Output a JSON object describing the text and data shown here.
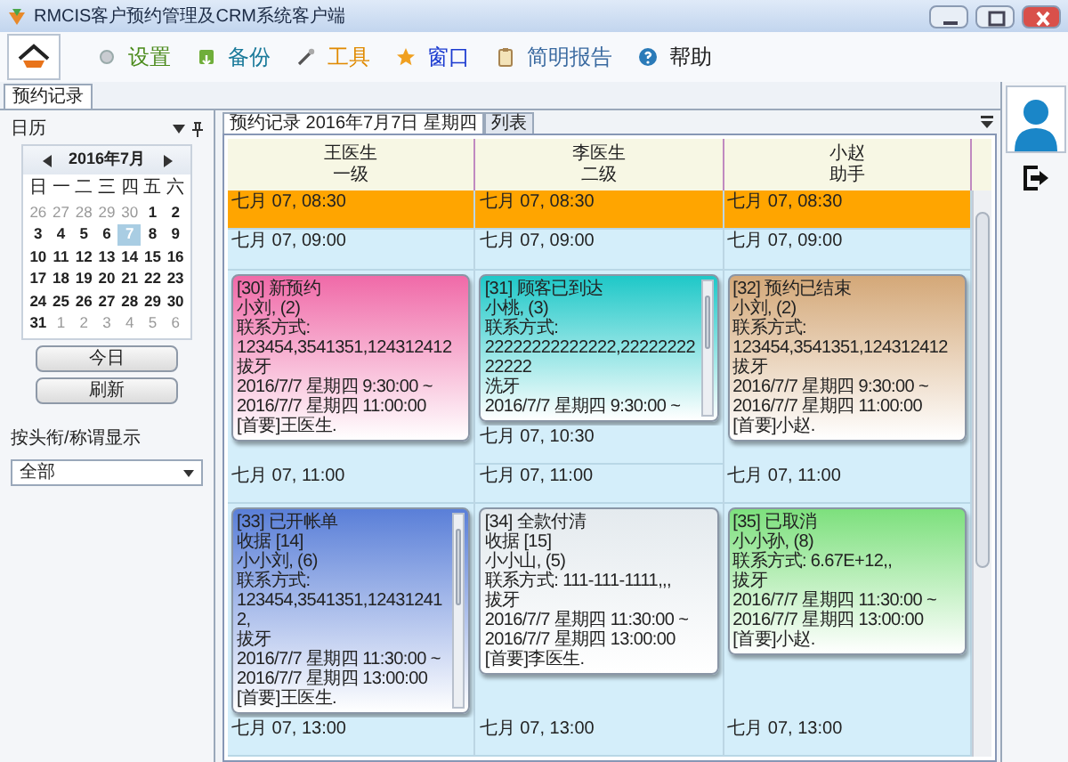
{
  "window": {
    "title": "RMCIS客户预约管理及CRM系统客户端"
  },
  "toolbar": [
    {
      "label": "设置",
      "color": "#4a8a1a"
    },
    {
      "label": "备份",
      "color": "#1a7a9a"
    },
    {
      "label": "工具",
      "color": "#e08a00"
    },
    {
      "label": "窗口",
      "color": "#1a3ad0"
    },
    {
      "label": "简明报告",
      "color": "#3a6aa0"
    },
    {
      "label": "帮助",
      "color": "#222222"
    }
  ],
  "tabs": [
    {
      "label": "预约记录",
      "selected": true
    }
  ],
  "calendar": {
    "title": "日历",
    "month": "2016年7月",
    "weekdays": [
      "日",
      "一",
      "二",
      "三",
      "四",
      "五",
      "六"
    ],
    "weeks": [
      [
        {
          "day": "26",
          "muted": true,
          "selected": false
        },
        {
          "day": "27",
          "muted": true,
          "selected": false
        },
        {
          "day": "28",
          "muted": true,
          "selected": false
        },
        {
          "day": "29",
          "muted": true,
          "selected": false
        },
        {
          "day": "30",
          "muted": true,
          "selected": false
        },
        {
          "day": "1",
          "muted": false,
          "selected": false
        },
        {
          "day": "2",
          "muted": false,
          "selected": false
        }
      ],
      [
        {
          "day": "3",
          "muted": false,
          "selected": false
        },
        {
          "day": "4",
          "muted": false,
          "selected": false
        },
        {
          "day": "5",
          "muted": false,
          "selected": false
        },
        {
          "day": "6",
          "muted": false,
          "selected": false
        },
        {
          "day": "7",
          "muted": false,
          "selected": true
        },
        {
          "day": "8",
          "muted": false,
          "selected": false
        },
        {
          "day": "9",
          "muted": false,
          "selected": false
        }
      ],
      [
        {
          "day": "10",
          "muted": false,
          "selected": false
        },
        {
          "day": "11",
          "muted": false,
          "selected": false
        },
        {
          "day": "12",
          "muted": false,
          "selected": false
        },
        {
          "day": "13",
          "muted": false,
          "selected": false
        },
        {
          "day": "14",
          "muted": false,
          "selected": false
        },
        {
          "day": "15",
          "muted": false,
          "selected": false
        },
        {
          "day": "16",
          "muted": false,
          "selected": false
        }
      ],
      [
        {
          "day": "17",
          "muted": false,
          "selected": false
        },
        {
          "day": "18",
          "muted": false,
          "selected": false
        },
        {
          "day": "19",
          "muted": false,
          "selected": false
        },
        {
          "day": "20",
          "muted": false,
          "selected": false
        },
        {
          "day": "21",
          "muted": false,
          "selected": false
        },
        {
          "day": "22",
          "muted": false,
          "selected": false
        },
        {
          "day": "23",
          "muted": false,
          "selected": false
        }
      ],
      [
        {
          "day": "24",
          "muted": false,
          "selected": false
        },
        {
          "day": "25",
          "muted": false,
          "selected": false
        },
        {
          "day": "26",
          "muted": false,
          "selected": false
        },
        {
          "day": "27",
          "muted": false,
          "selected": false
        },
        {
          "day": "28",
          "muted": false,
          "selected": false
        },
        {
          "day": "29",
          "muted": false,
          "selected": false
        },
        {
          "day": "30",
          "muted": false,
          "selected": false
        }
      ],
      [
        {
          "day": "31",
          "muted": false,
          "selected": false
        },
        {
          "day": "1",
          "muted": true,
          "selected": false
        },
        {
          "day": "2",
          "muted": true,
          "selected": false
        },
        {
          "day": "3",
          "muted": true,
          "selected": false
        },
        {
          "day": "4",
          "muted": true,
          "selected": false
        },
        {
          "day": "5",
          "muted": true,
          "selected": false
        },
        {
          "day": "6",
          "muted": true,
          "selected": false
        }
      ]
    ]
  },
  "side_buttons": [
    "今日",
    "刷新"
  ],
  "filter": {
    "label": "按头衔/称谓显示",
    "value": "全部"
  },
  "view_tabs": [
    {
      "label": "预约记录 2016年7月7日 星期四",
      "selected": true
    },
    {
      "label": "列表",
      "selected": false
    }
  ],
  "columns": [
    {
      "name": "王医生",
      "role": "一级"
    },
    {
      "name": "李医生",
      "role": "二级"
    },
    {
      "name": "小赵",
      "role": "助手"
    }
  ],
  "rows": [
    {
      "cells": [
        [
          {
            "kind": "slot",
            "time": "七月 07, 08:30",
            "highlighted": true
          }
        ],
        [
          {
            "kind": "slot",
            "time": "七月 07, 08:30",
            "highlighted": true
          }
        ],
        [
          {
            "kind": "slot",
            "time": "七月 07, 08:30",
            "highlighted": true
          }
        ]
      ]
    },
    {
      "cells": [
        [
          {
            "kind": "slot",
            "time": "七月 07, 09:00",
            "highlighted": false
          }
        ],
        [
          {
            "kind": "slot",
            "time": "七月 07, 09:00",
            "highlighted": false
          }
        ],
        [
          {
            "kind": "slot",
            "time": "七月 07, 09:00",
            "highlighted": false
          }
        ]
      ]
    },
    {
      "cells": [
        [
          {
            "kind": "appointment",
            "color": "#f06aa8",
            "scrollable": false,
            "lines": [
              "[30] 新预约",
              "小刘, (2)",
              "联系方式:",
              "123454,3541351,124312412",
              "拔牙",
              "2016/7/7 星期四 9:30:00 ~ 2016/7/7 星期四 11:00:00",
              "[首要]王医生."
            ]
          }
        ],
        [
          {
            "kind": "appointment",
            "color": "#1ec8c8",
            "scrollable": true,
            "lines": [
              "[31] 顾客已到达",
              "小桃, (3)",
              "联系方式:",
              "22222222222222,2222222222222",
              "洗牙",
              "2016/7/7 星期四 9:30:00 ~"
            ]
          },
          {
            "kind": "slot",
            "time": "七月 07, 10:30",
            "highlighted": false
          }
        ],
        [
          {
            "kind": "appointment",
            "color": "#d4a878",
            "scrollable": false,
            "lines": [
              "[32] 预约已结束",
              "小刘, (2)",
              "联系方式:",
              "123454,3541351,124312412",
              "拔牙",
              "2016/7/7 星期四 9:30:00 ~ 2016/7/7 星期四 11:00:00",
              "[首要]小赵."
            ]
          }
        ]
      ]
    },
    {
      "cells": [
        [
          {
            "kind": "slot",
            "time": "七月 07, 11:00",
            "highlighted": false
          }
        ],
        [
          {
            "kind": "slot",
            "time": "七月 07, 11:00",
            "highlighted": false
          }
        ],
        [
          {
            "kind": "slot",
            "time": "七月 07, 11:00",
            "highlighted": false
          }
        ]
      ]
    },
    {
      "cells": [
        [
          {
            "kind": "appointment",
            "color": "#5a7fd8",
            "scrollable": true,
            "lines": [
              "[33] 已开帐单",
              "收据 [14]",
              "小小刘, (6)",
              "联系方式:",
              "123454,3541351,124312412,",
              "拔牙",
              "2016/7/7 星期四 11:30:00 ~ 2016/7/7 星期四 13:00:00",
              "[首要]王医生."
            ]
          }
        ],
        [
          {
            "kind": "appointment",
            "color": "#e4eaee",
            "scrollable": false,
            "lines": [
              "[34] 全款付清",
              "收据 [15]",
              "小小山, (5)",
              "联系方式: 111-111-1111,,,",
              "拔牙",
              "2016/7/7 星期四 11:30:00 ~ 2016/7/7 星期四 13:00:00",
              "[首要]李医生."
            ]
          }
        ],
        [
          {
            "kind": "appointment",
            "color": "#7de07d",
            "scrollable": false,
            "lines": [
              "[35] 已取消",
              "小小孙, (8)",
              "联系方式: 6.67E+12,,",
              "拔牙",
              "2016/7/7 星期四 11:30:00 ~ 2016/7/7 星期四 13:00:00",
              "[首要]小赵."
            ]
          }
        ]
      ]
    },
    {
      "cells": [
        [
          {
            "kind": "slot",
            "time": "七月 07, 13:00",
            "highlighted": false
          }
        ],
        [
          {
            "kind": "slot",
            "time": "七月 07, 13:00",
            "highlighted": false
          }
        ],
        [
          {
            "kind": "slot",
            "time": "七月 07, 13:00",
            "highlighted": false
          }
        ]
      ]
    }
  ]
}
